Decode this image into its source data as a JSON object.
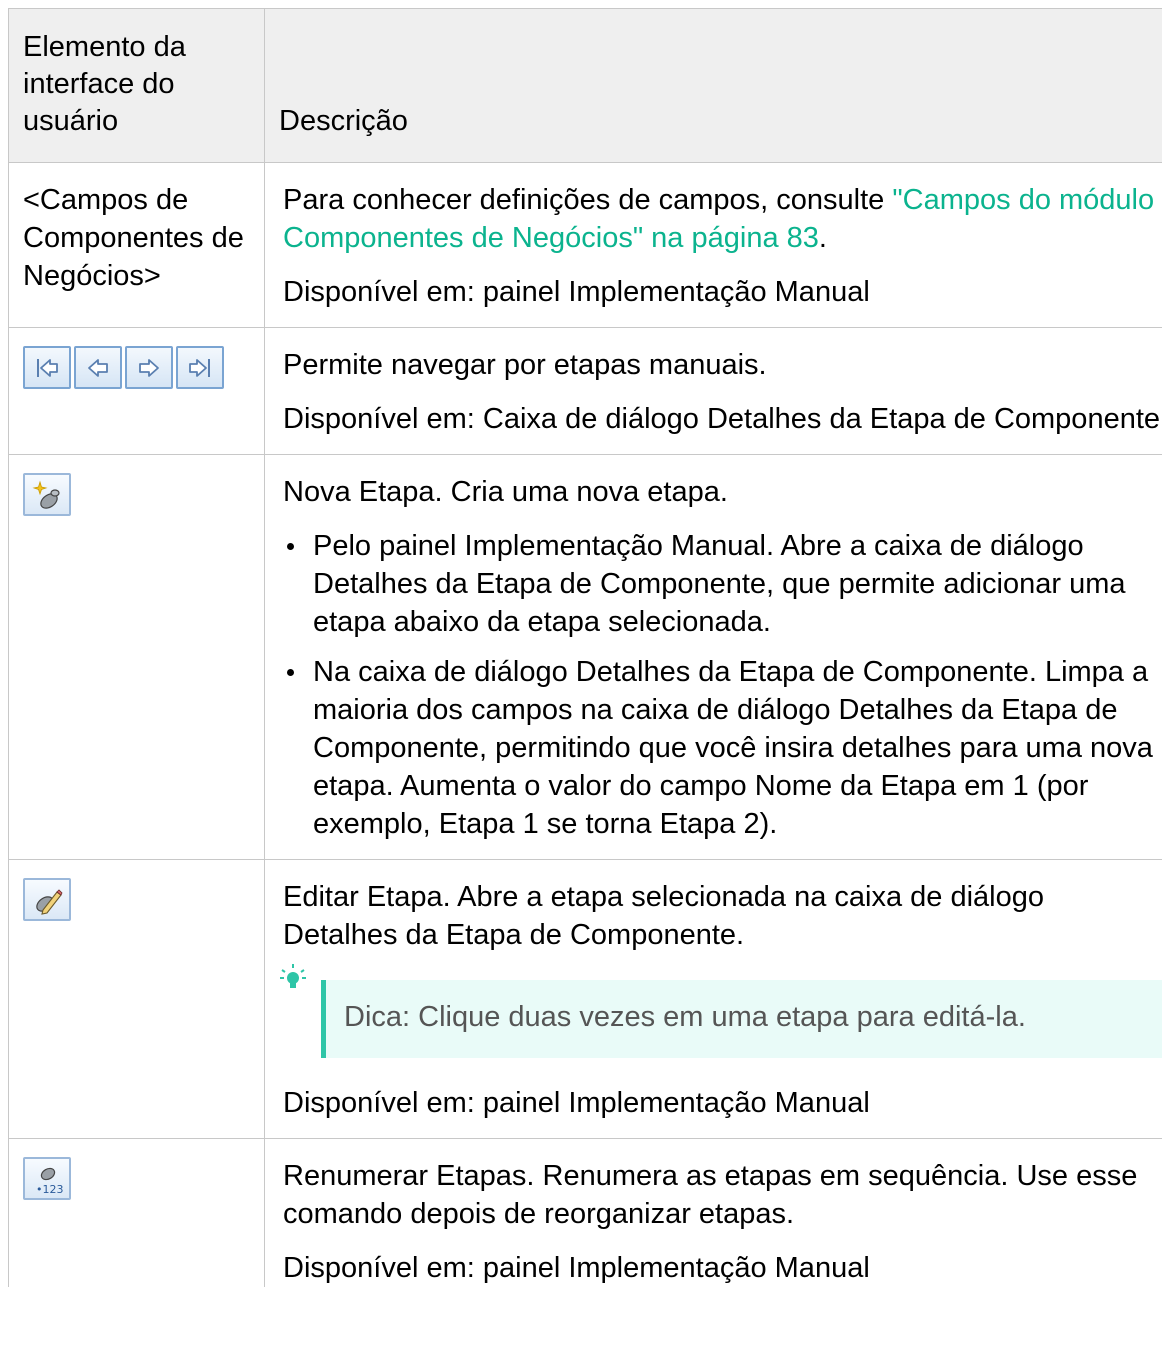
{
  "header": {
    "col1": "Elemento da interface do usuário",
    "col2": "Descrição"
  },
  "rows": [
    {
      "element": "<Campos de Componentes de Negócios>",
      "text_before_link": "Para conhecer definições de campos, consulte ",
      "link": "\"Campos do módulo Componentes de Negócios\" na página 83",
      "text_after_link": ".",
      "avail_label": "Disponível em:",
      "avail_text": " painel Implementação Manual"
    },
    {
      "icons": [
        "first-step-icon",
        "previous-step-icon",
        "next-step-icon",
        "last-step-icon"
      ],
      "desc": "Permite navegar por etapas manuais.",
      "avail_label": "Disponível em:",
      "avail_text": " Caixa de diálogo Detalhes da Etapa de Componente"
    },
    {
      "icon": "new-step-icon",
      "title": "Nova Etapa.",
      "desc": " Cria uma nova etapa.",
      "bullet1_title": "Pelo painel Implementação Manual.",
      "bullet1_text": " Abre a caixa de diálogo Detalhes da Etapa de Componente, que permite adicionar uma etapa abaixo da etapa selecionada.",
      "bullet2_title": "Na caixa de diálogo Detalhes da Etapa de Componente.",
      "bullet2_text_a": " Limpa a maioria dos campos na caixa de diálogo Detalhes da Etapa de Componente, permitindo que você insira detalhes para uma nova etapa. Aumenta o valor do campo ",
      "bullet2_b1": "Nome da Etapa",
      "bullet2_text_b": " em 1 (por exemplo, ",
      "bullet2_b2": "Etapa 1",
      "bullet2_text_c": " se torna ",
      "bullet2_b3": "Etapa 2",
      "bullet2_text_d": ")."
    },
    {
      "icon": "edit-step-icon",
      "title": "Editar Etapa.",
      "desc": " Abre a etapa selecionada na caixa de diálogo Detalhes da Etapa de Componente.",
      "tip_label": "Dica:",
      "tip_text": " Clique duas vezes em uma etapa para editá-la.",
      "avail_label": "Disponível em:",
      "avail_text": " painel Implementação Manual"
    },
    {
      "icon": "renumber-steps-icon",
      "title": "Renumerar Etapas.",
      "desc": " Renumera as etapas em sequência. Use esse comando depois de reorganizar etapas.",
      "avail_label": "Disponível em:",
      "avail_text": " painel Implementação Manual"
    }
  ],
  "colors": {
    "link": "#0bb38e",
    "tip_bg": "#e9fbf8",
    "tip_bar": "#2ec5a7",
    "header_bg": "#efefef"
  }
}
